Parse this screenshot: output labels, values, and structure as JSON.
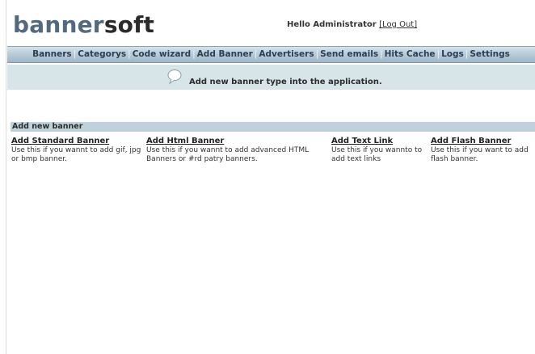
{
  "header": {
    "logo_part1": "banner",
    "logo_part2": "soft",
    "greeting": "Hello Administrator",
    "logout_label": "[Log Out]"
  },
  "nav": {
    "items": [
      "Banners",
      "Categorys",
      "Code wizard",
      "Add Banner",
      "Advertisers",
      "Send emails",
      "Hits Cache",
      "Logs",
      "Settings"
    ]
  },
  "info": {
    "message": "Add new banner type into the application."
  },
  "section": {
    "title": "Add new banner",
    "options": [
      {
        "title": "Add Standard Banner",
        "description": "Use this if you wannt to add gif, jpg or bmp banner."
      },
      {
        "title": "Add Html Banner",
        "description": "Use this if you wannt to add advanced HTML Banners or #rd patry banners."
      },
      {
        "title": "Add Text Link",
        "description": "Use this if you wannto to add text links"
      },
      {
        "title": "Add Flash Banner",
        "description": "Use this if you want to add flash banner."
      }
    ]
  },
  "colors": {
    "logo_blue": "#52697e",
    "nav_text": "#2a3f52",
    "info_bg": "#d7e5e9",
    "section_bg": "#bfd1dc"
  }
}
